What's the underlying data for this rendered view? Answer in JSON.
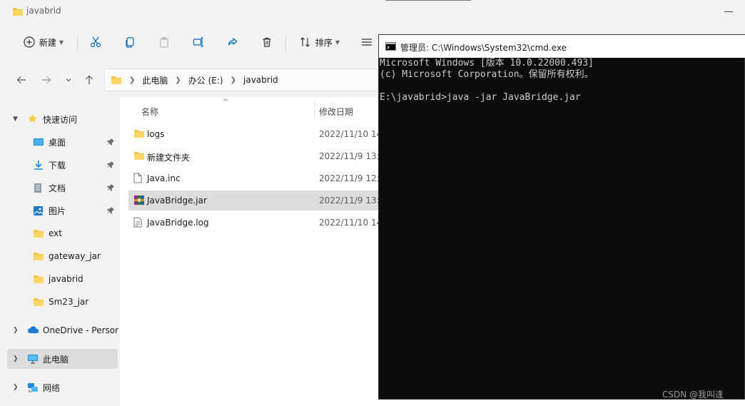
{
  "explorer": {
    "title": "javabrid",
    "toolbar": {
      "new_label": "新建",
      "sort_label": "排序"
    },
    "address": {
      "crumbs": [
        "此电脑",
        "办公 (E:)",
        "javabrid"
      ]
    },
    "sidebar": {
      "quick_access": "快速访问",
      "pinned": [
        {
          "label": "桌面",
          "icon": "desktop-icon"
        },
        {
          "label": "下载",
          "icon": "download-icon"
        },
        {
          "label": "文档",
          "icon": "document-icon"
        },
        {
          "label": "图片",
          "icon": "picture-icon"
        }
      ],
      "folders": [
        "ext",
        "gateway_jar",
        "javabrid",
        "Sm23_jar"
      ],
      "onedrive": "OneDrive - Persor",
      "this_pc": "此电脑",
      "network": "网络"
    },
    "columns": {
      "name": "名称",
      "date": "修改日期"
    },
    "files": [
      {
        "name": "logs",
        "date": "2022/11/10 14",
        "icon": "folder-icon"
      },
      {
        "name": "新建文件夹",
        "date": "2022/11/9 13:5",
        "icon": "folder-icon"
      },
      {
        "name": "Java.inc",
        "date": "2022/11/9 12:1",
        "icon": "file-icon"
      },
      {
        "name": "JavaBridge.jar",
        "date": "2022/11/9 13:3",
        "icon": "jar-archive-icon",
        "selected": true
      },
      {
        "name": "JavaBridge.log",
        "date": "2022/11/10 14",
        "icon": "log-file-icon"
      }
    ]
  },
  "cmd": {
    "title": "管理员: C:\\Windows\\System32\\cmd.exe",
    "lines": [
      "Microsoft Windows [版本 10.0.22000.493]",
      "(c) Microsoft Corporation。保留所有权利。",
      "",
      "E:\\javabrid>java -jar JavaBridge.jar"
    ]
  },
  "watermark": "CSDN @我叫逢",
  "colors": {
    "folder": "#f5c347",
    "accent": "#0067c0",
    "cmd_bg": "#0c0c0c",
    "cmd_fg": "#cccccc"
  }
}
